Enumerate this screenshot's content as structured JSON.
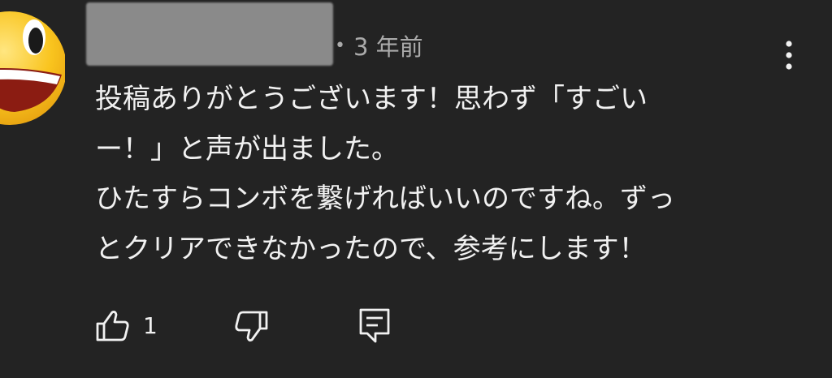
{
  "comment": {
    "timestamp": "3 年前",
    "lines": [
      "投稿ありがとうございます！思わず「すごい",
      "ー！」と声が出ました。",
      "ひたすらコンボを繋げればいいのですね。ずっ",
      "とクリアできなかったので、参考にします！"
    ],
    "like_count": "1"
  },
  "icons": {
    "avatar": "grinning-face-emoji",
    "menu": "more-vertical-icon",
    "like": "thumbs-up-icon",
    "dislike": "thumbs-down-icon",
    "reply": "comment-reply-icon"
  },
  "colors": {
    "background": "#232323",
    "text": "#f1f1f1",
    "secondary_text": "#aaaaaa"
  }
}
